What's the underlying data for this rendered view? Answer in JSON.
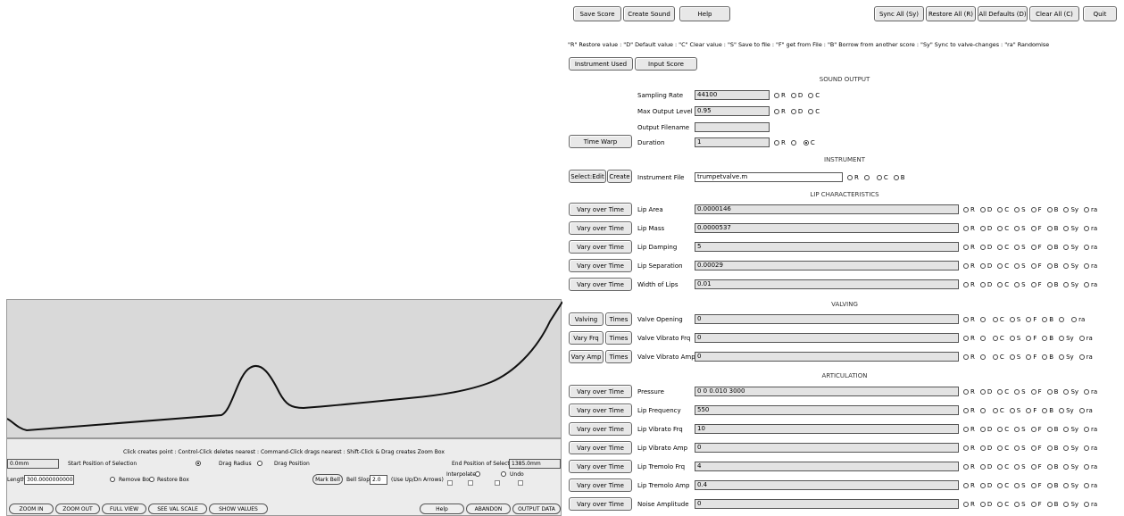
{
  "toolbar": {
    "save_score": "Save Score",
    "create_sound": "Create Sound",
    "help": "Help",
    "sync_all": "Sync All (Sy)",
    "restore_all": "Restore All (R)",
    "all_defaults": "All Defaults (D)",
    "clear_all": "Clear All (C)",
    "quit": "Quit"
  },
  "legend": "\"R\" Restore value  :  \"D\" Default value  :  \"C\" Clear value  :  \"S\" Save to file  :  \"F\" get from File  :  \"B\" Borrow from another score  :  \"Sy\" Sync to valve-changes  :  \"ra\" Randomise",
  "tabs": {
    "instrument_used": "Instrument Used",
    "input_score": "Input Score"
  },
  "sound_output": {
    "header": "SOUND OUTPUT",
    "sampling_rate_label": "Sampling Rate",
    "sampling_rate": "44100",
    "max_output_label": "Max Output Level",
    "max_output": "0.95",
    "output_filename_label": "Output Filename",
    "output_filename": "",
    "time_warp": "Time Warp",
    "duration_label": "Duration",
    "duration": "1"
  },
  "instrument": {
    "header": "INSTRUMENT",
    "select_edit": "Select:Edit",
    "create": "Create",
    "file_label": "Instrument File",
    "file": "trumpetvalve.m"
  },
  "radio": {
    "R": "R",
    "D": "D",
    "C": "C",
    "S": "S",
    "F": "F",
    "B": "B",
    "Sy": "Sy",
    "ra": "ra"
  },
  "lip": {
    "header": "LIP CHARACTERISTICS",
    "vary": "Vary over Time",
    "rows": [
      {
        "label": "Lip Area",
        "value": "0.0000146"
      },
      {
        "label": "Lip Mass",
        "value": "0.0000537"
      },
      {
        "label": "Lip Damping",
        "value": "5"
      },
      {
        "label": "Lip Separation",
        "value": "0.00029"
      },
      {
        "label": "Width of Lips",
        "value": "0.01"
      }
    ]
  },
  "valving": {
    "header": "VALVING",
    "times": "Times",
    "rows": [
      {
        "button": "Valving",
        "label": "Valve Opening",
        "value": "0"
      },
      {
        "button": "Vary Frq",
        "label": "Valve Vibrato Frq",
        "value": "0"
      },
      {
        "button": "Vary Amp",
        "label": "Valve Vibrato Amp",
        "value": "0"
      }
    ]
  },
  "articulation": {
    "header": "ARTICULATION",
    "vary": "Vary over Time",
    "rows": [
      {
        "label": "Pressure",
        "value": "0 0 0.010 3000"
      },
      {
        "label": "Lip Frequency",
        "value": "550"
      },
      {
        "label": "Lip Vibrato Frq",
        "value": "10"
      },
      {
        "label": "Lip Vibrato Amp",
        "value": "0"
      },
      {
        "label": "Lip Tremolo Frq",
        "value": "4"
      },
      {
        "label": "Lip Tremolo Amp",
        "value": "0.4"
      },
      {
        "label": "Noise Amplitude",
        "value": "0"
      }
    ]
  },
  "bore": {
    "hint": "Click creates point : Control-Click deletes nearest : Command-Click drags nearest : Shift-Click & Drag creates Zoom Box",
    "start_value": "0.0mm",
    "start_label": "Start Position of Selection",
    "drag_radius": "Drag Radius",
    "drag_position": "Drag Position",
    "end_label": "End Position of Selection",
    "end_value": "1385.0mm",
    "length_label": "Length",
    "length_value": "300.00000000001mm",
    "remove_box": "Remove Box",
    "restore_box": "Restore Box",
    "mark_bell": "Mark Bell",
    "bell_slope_label": "Bell Slope",
    "bell_slope": "2.0",
    "arrows_hint": "(Use Up/Dn Arrows)",
    "interpolate": "Interpolate",
    "undo": "Undo",
    "zoom_in": "ZOOM IN",
    "zoom_out": "ZOOM OUT",
    "full_view": "FULL VIEW",
    "see_val_scale": "SEE VAL SCALE",
    "show_values": "SHOW VALUES",
    "help": "Help",
    "abandon": "ABANDON",
    "output_data": "OUTPUT DATA"
  }
}
